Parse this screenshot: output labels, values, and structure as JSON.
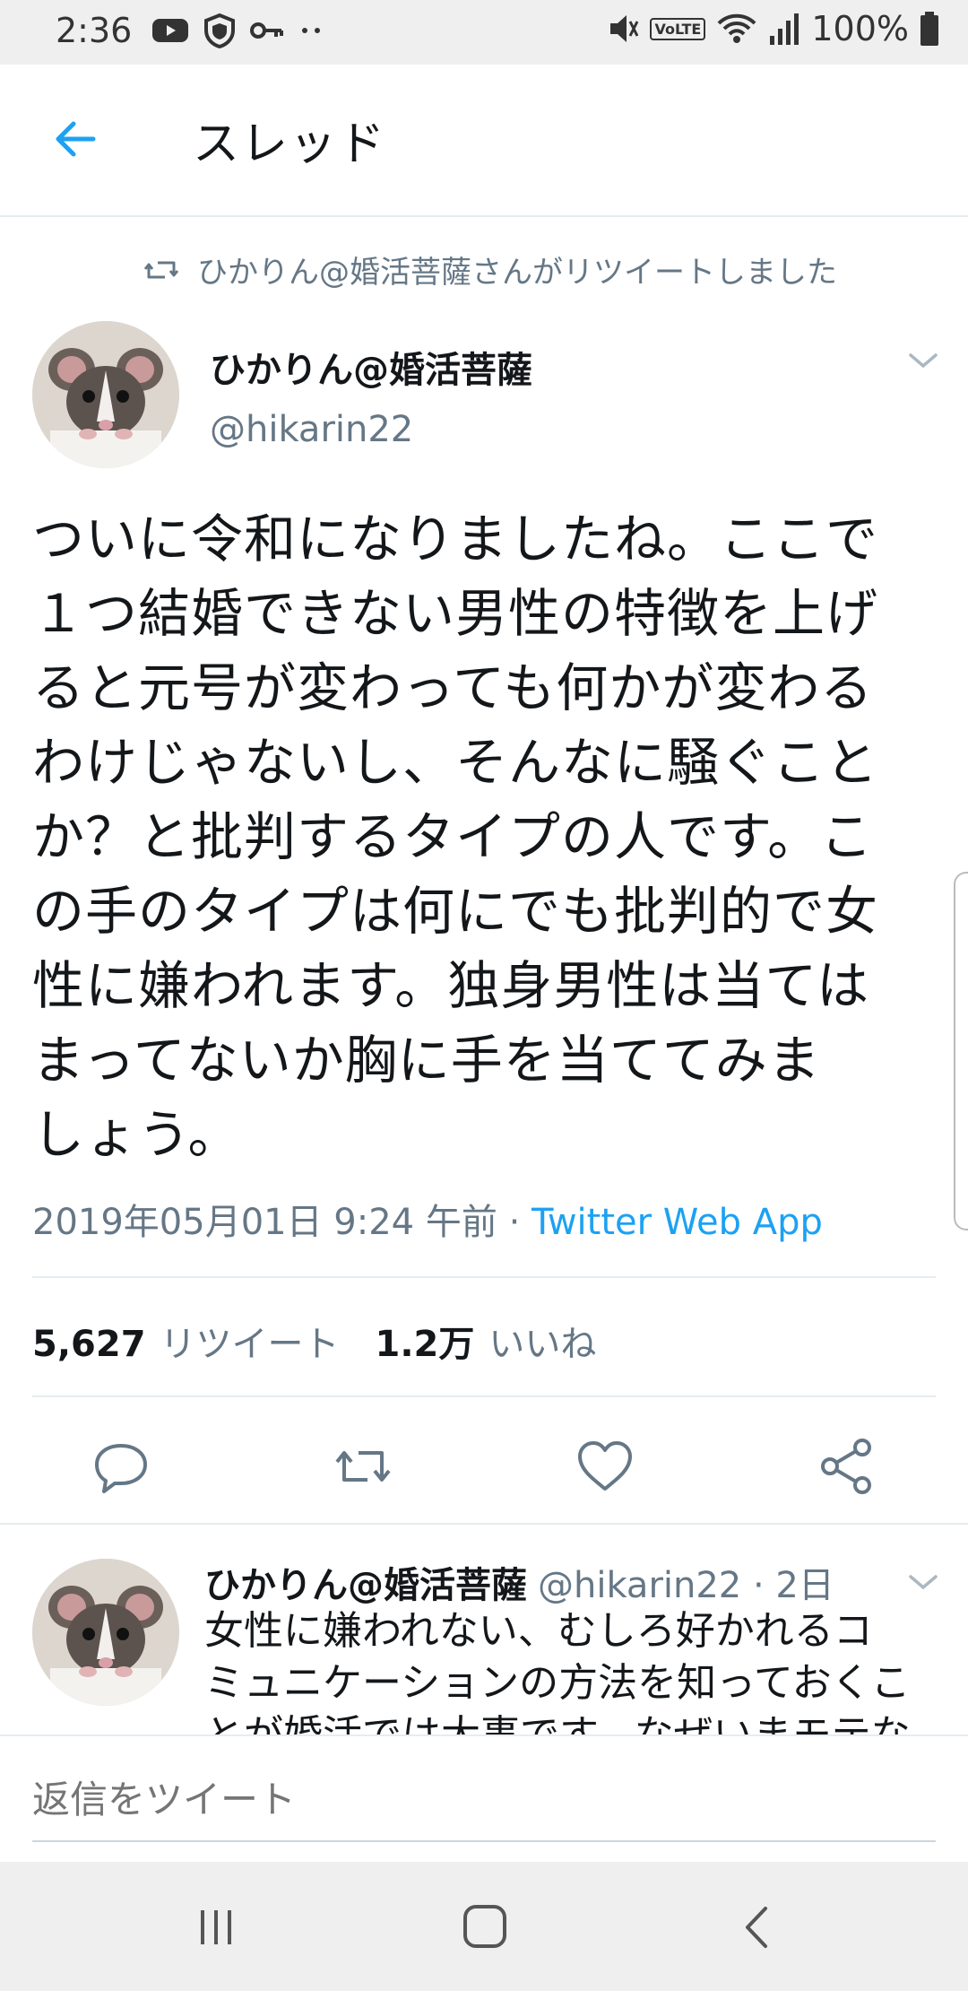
{
  "status_bar": {
    "time": "2:36",
    "volte": "VoLTE",
    "battery": "100%"
  },
  "header": {
    "title": "スレッド"
  },
  "tweet": {
    "retweet_notice": "ひかりん@婚活菩薩さんがリツイートしました",
    "display_name": "ひかりん@婚活菩薩",
    "handle": "@hikarin22",
    "body_lines": [
      "ついに令和になりましたね。ここで",
      "１つ結婚できない男性の特徴を上げ",
      "ると元号が変わっても何かが変わる",
      "わけじゃないし、そんなに騒ぐこと",
      "か？と批判するタイプの人です。こ",
      "の手のタイプは何にでも批判的で女",
      "性に嫌われます。独身男性は当ては",
      "まってないか胸に手を当ててみま",
      "しょう。"
    ],
    "timestamp": "2019年05月01日 9:24 午前",
    "separator": " · ",
    "source": "Twitter Web App",
    "retweet_count": "5,627",
    "retweet_label": "リツイート",
    "like_count": "1.2万",
    "like_label": "いいね"
  },
  "reply": {
    "display_name": "ひかりん@婚活菩薩",
    "handle_time": "@hikarin22 · 2日",
    "text_lines": [
      "女性に嫌われない、むしろ好かれるコ",
      "ミュニケーションの方法を知っておくこ",
      "とが婚活では大事です。なぜいまモテな"
    ]
  },
  "compose": {
    "placeholder": "返信をツイート"
  },
  "colors": {
    "accent": "#1da1f2",
    "secondary_text": "#657786",
    "divider": "#e6ecf0"
  },
  "icons": [
    "youtube-icon",
    "shield-icon",
    "key-icon",
    "more-dots-icon",
    "mute-icon",
    "wifi-icon",
    "signal-icon",
    "battery-icon",
    "back-arrow-icon",
    "retweet-icon",
    "chevron-down-icon",
    "reply-icon",
    "like-icon",
    "share-icon",
    "recents-icon",
    "home-icon",
    "nav-back-icon"
  ]
}
